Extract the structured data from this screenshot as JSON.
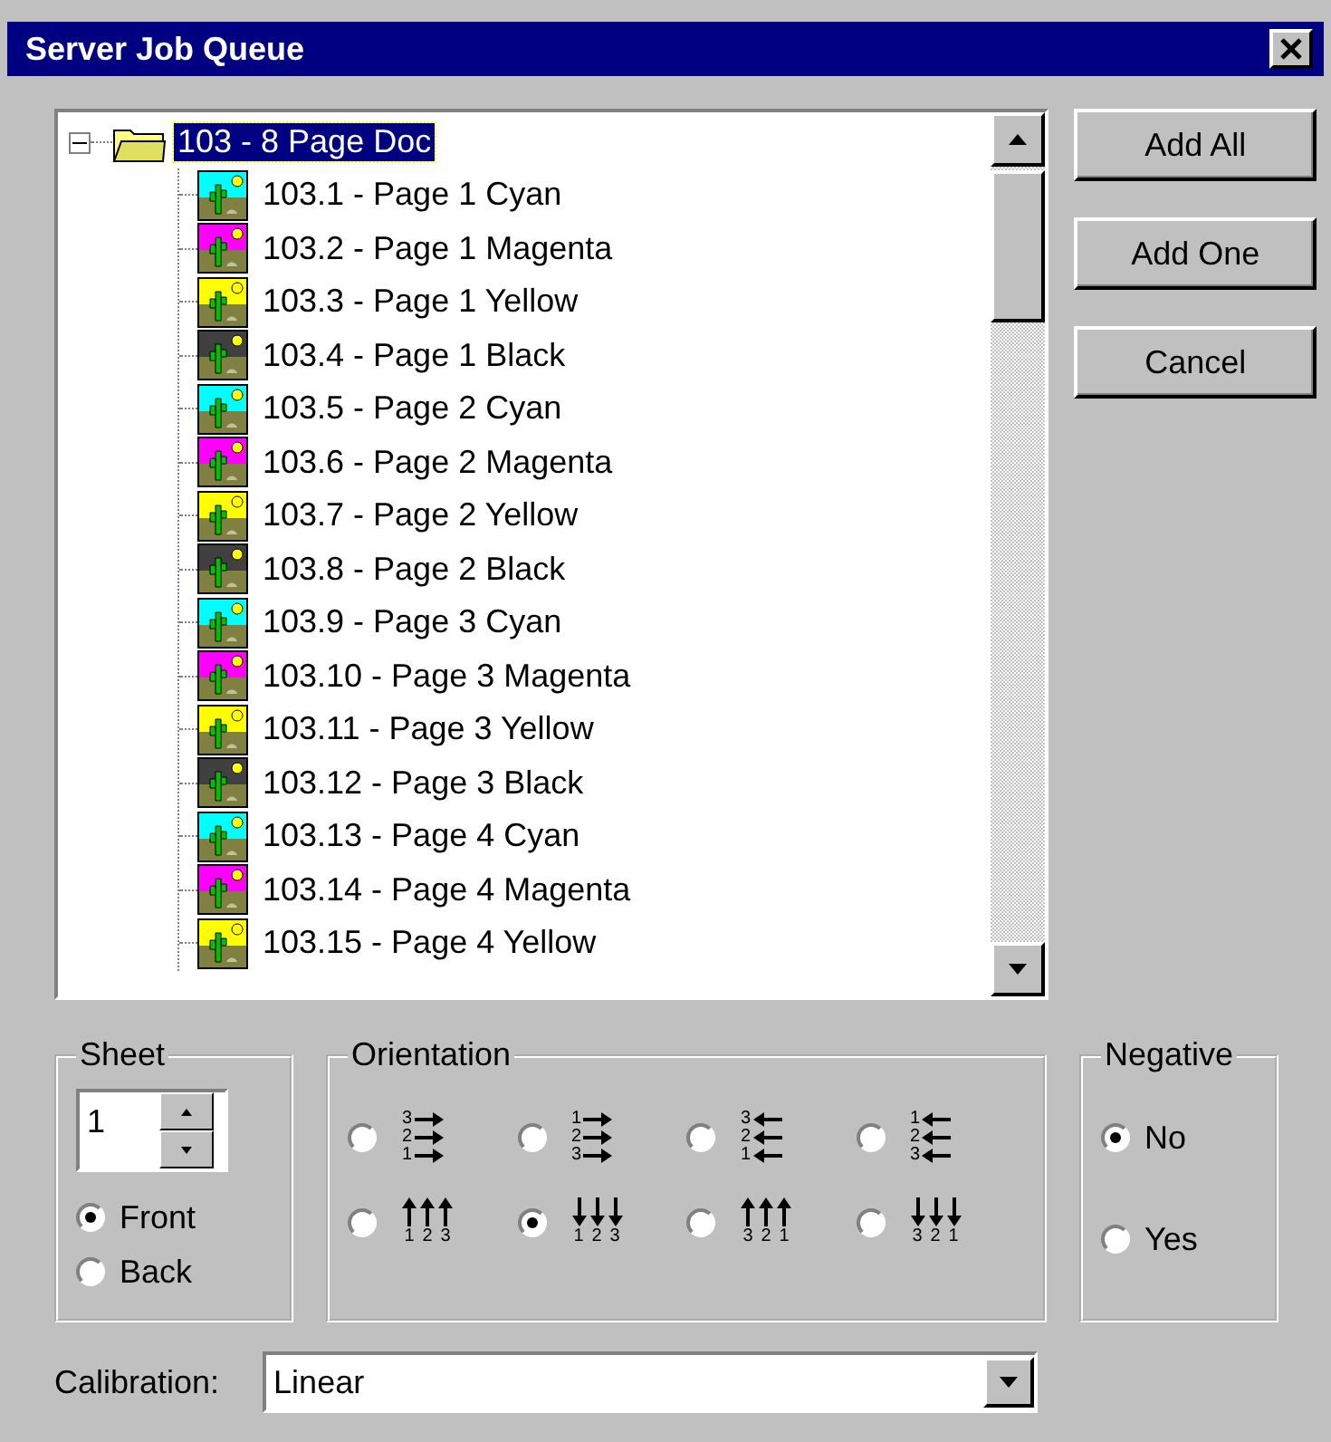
{
  "window": {
    "title": "Server Job Queue"
  },
  "tree": {
    "root": {
      "label": "103 - 8 Page Doc",
      "expanded": true,
      "selected": true,
      "children": [
        {
          "label": "103.1 - Page 1 Cyan",
          "color": "#00ffff"
        },
        {
          "label": "103.2 - Page 1 Magenta",
          "color": "#ff00ff"
        },
        {
          "label": "103.3 - Page 1 Yellow",
          "color": "#ffff00"
        },
        {
          "label": "103.4 - Page 1 Black",
          "color": "#404040"
        },
        {
          "label": "103.5 - Page 2 Cyan",
          "color": "#00ffff"
        },
        {
          "label": "103.6 - Page 2 Magenta",
          "color": "#ff00ff"
        },
        {
          "label": "103.7 - Page 2 Yellow",
          "color": "#ffff00"
        },
        {
          "label": "103.8 - Page 2 Black",
          "color": "#404040"
        },
        {
          "label": "103.9 - Page 3 Cyan",
          "color": "#00ffff"
        },
        {
          "label": "103.10 - Page 3 Magenta",
          "color": "#ff00ff"
        },
        {
          "label": "103.11 - Page 3 Yellow",
          "color": "#ffff00"
        },
        {
          "label": "103.12 - Page 3 Black",
          "color": "#404040"
        },
        {
          "label": "103.13 - Page 4 Cyan",
          "color": "#00ffff"
        },
        {
          "label": "103.14 - Page 4 Magenta",
          "color": "#ff00ff"
        },
        {
          "label": "103.15 - Page 4 Yellow",
          "color": "#ffff00"
        }
      ]
    }
  },
  "buttons": [
    "Add All",
    "Add One",
    "Cancel"
  ],
  "sheet": {
    "title": "Sheet",
    "value": "1",
    "sides": [
      {
        "label": "Front",
        "selected": true
      },
      {
        "label": "Back",
        "selected": false
      }
    ]
  },
  "orientation": {
    "title": "Orientation",
    "options": [
      {
        "kind": "right",
        "digits": [
          "3",
          "2",
          "1"
        ],
        "selected": false
      },
      {
        "kind": "right",
        "digits": [
          "1",
          "2",
          "3"
        ],
        "selected": false
      },
      {
        "kind": "left",
        "digits": [
          "3",
          "2",
          "1"
        ],
        "selected": false
      },
      {
        "kind": "left",
        "digits": [
          "1",
          "2",
          "3"
        ],
        "selected": false
      },
      {
        "kind": "up",
        "digits": [
          "1",
          "2",
          "3"
        ],
        "selected": false
      },
      {
        "kind": "down",
        "digits": [
          "1",
          "2",
          "3"
        ],
        "selected": true
      },
      {
        "kind": "up",
        "digits": [
          "3",
          "2",
          "1"
        ],
        "selected": false
      },
      {
        "kind": "down",
        "digits": [
          "3",
          "2",
          "1"
        ],
        "selected": false
      }
    ]
  },
  "negative": {
    "title": "Negative",
    "options": [
      {
        "label": "No",
        "selected": true
      },
      {
        "label": "Yes",
        "selected": false
      }
    ]
  },
  "calibration": {
    "label": "Calibration:",
    "value": "Linear"
  }
}
